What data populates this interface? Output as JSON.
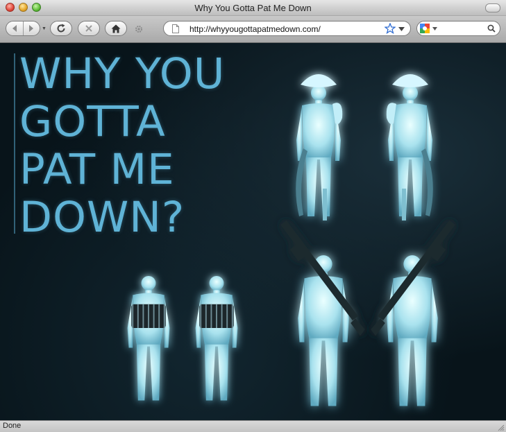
{
  "window": {
    "title": "Why You Gotta Pat Me Down"
  },
  "toolbar": {
    "back_icon": "back-arrow-icon",
    "forward_icon": "forward-arrow-icon",
    "reload_icon": "reload-icon",
    "stop_icon": "stop-icon",
    "home_icon": "home-icon",
    "activity_icon": "gear-icon"
  },
  "address_bar": {
    "url": "http://whyyougottapatmedown.com/"
  },
  "search_bar": {
    "engine": "google",
    "value": ""
  },
  "page": {
    "headline": [
      "WHY YOU",
      "GOTTA",
      "PAT ME",
      "DOWN?"
    ],
    "accent_color": "#5fb3d6",
    "background_color": "#08141a",
    "figures": [
      {
        "name": "pirate-front-figure",
        "accessory": "pirate hat, parrot, sword, peg leg"
      },
      {
        "name": "pirate-back-figure",
        "accessory": "pirate hat, parrot, sword, peg leg"
      },
      {
        "name": "bomb-belt-front-figure",
        "accessory": "explosive belt"
      },
      {
        "name": "bomb-belt-back-figure",
        "accessory": "explosive belt"
      },
      {
        "name": "rpg-front-figure",
        "accessory": "rocket launcher"
      },
      {
        "name": "rpg-back-figure",
        "accessory": "rocket launcher"
      }
    ]
  },
  "status_bar": {
    "text": "Done"
  }
}
